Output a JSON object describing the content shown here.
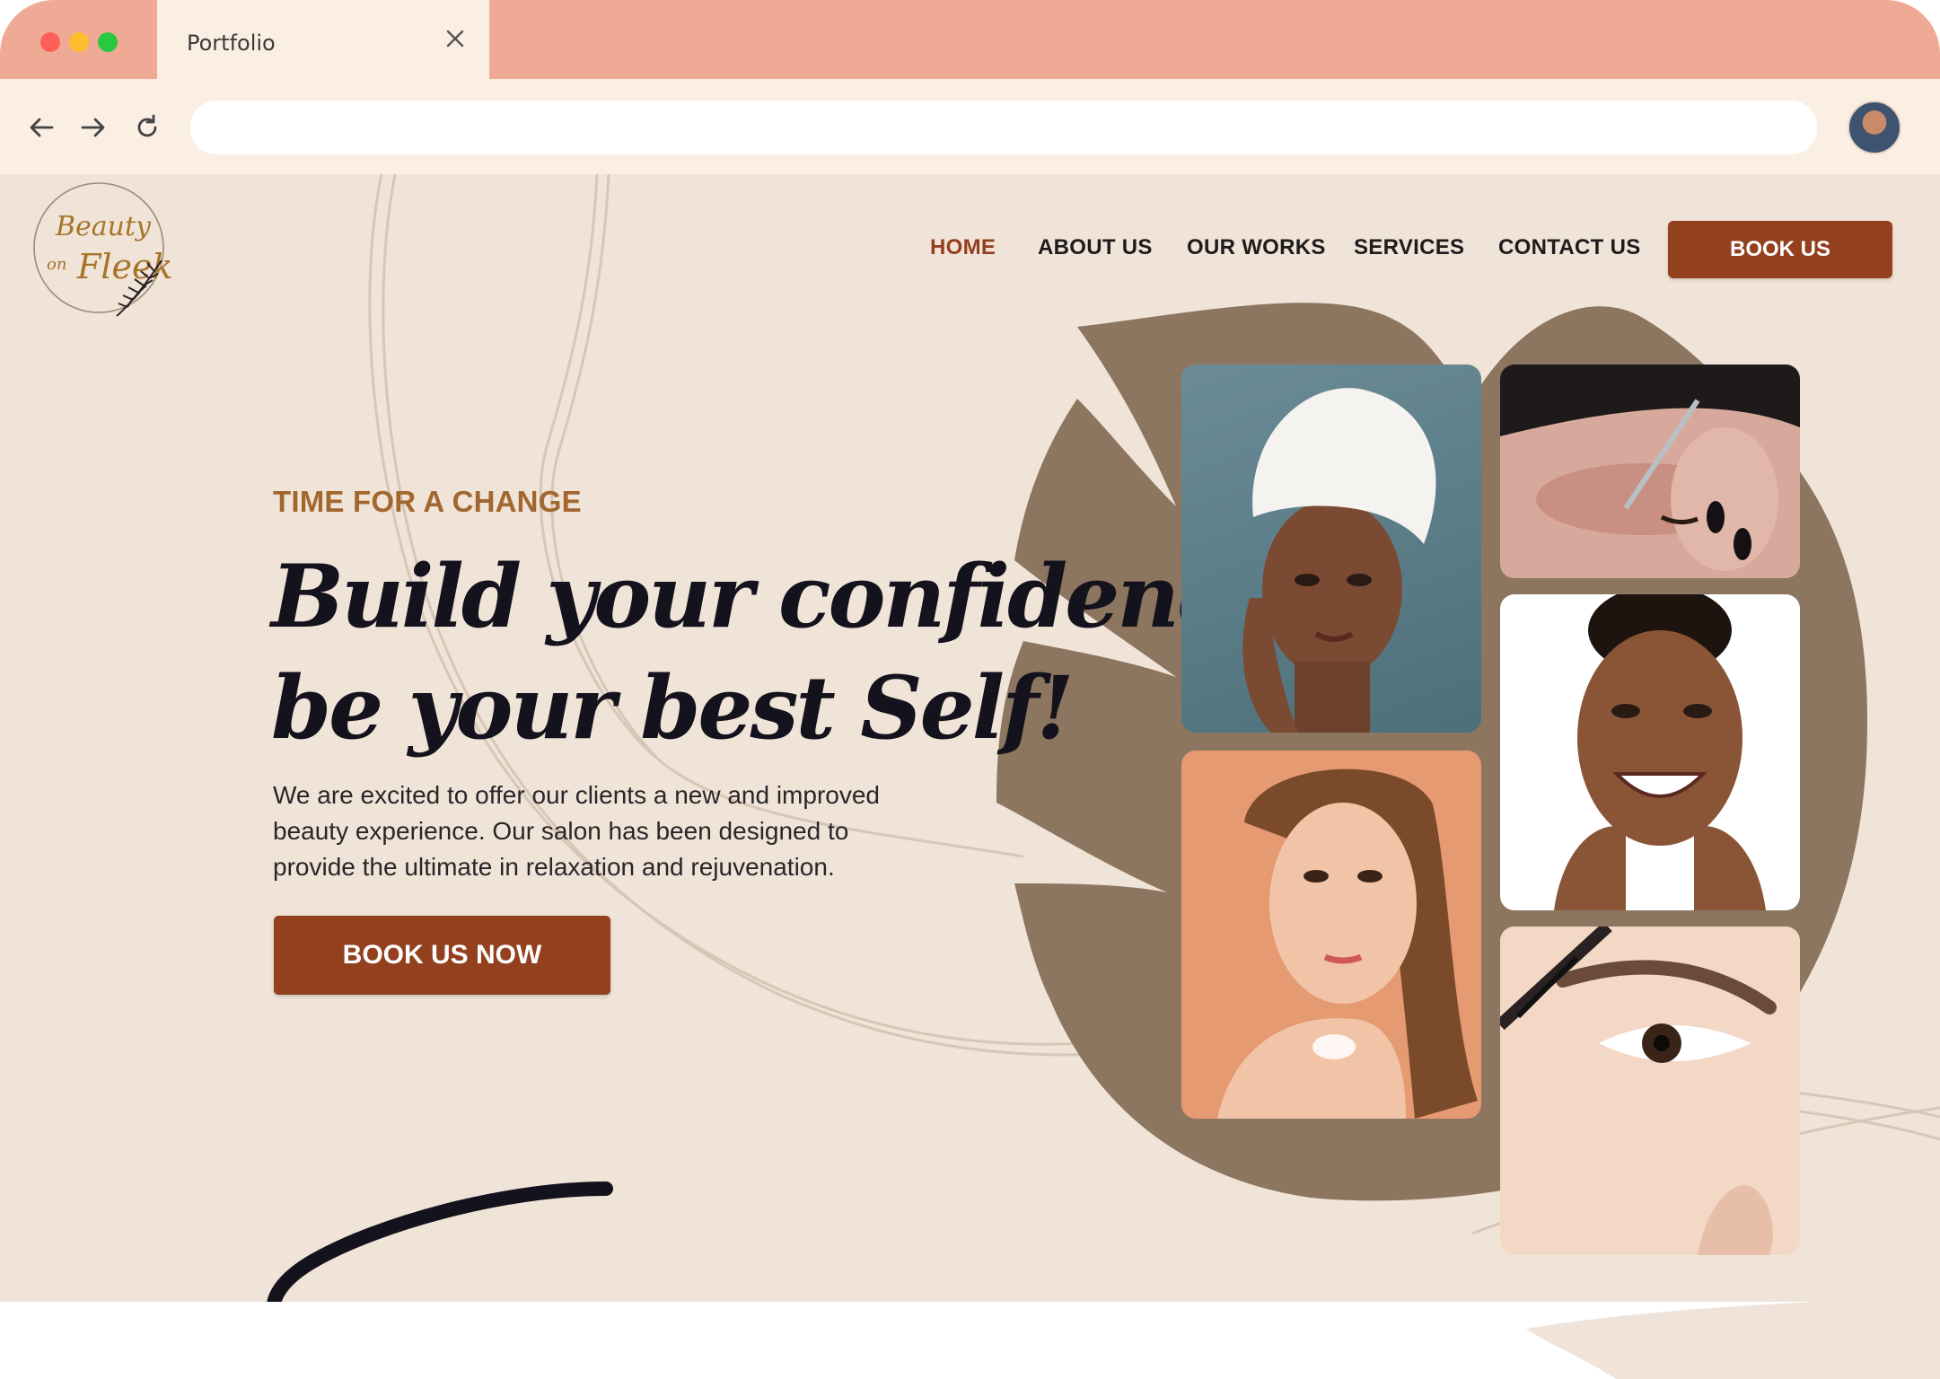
{
  "browser": {
    "tab_title": "Portfolio",
    "url": ""
  },
  "nav": {
    "items": [
      {
        "label": "HOME",
        "active": true
      },
      {
        "label": "ABOUT US",
        "active": false
      },
      {
        "label": "OUR WORKS",
        "active": false
      },
      {
        "label": "SERVICES",
        "active": false
      },
      {
        "label": "CONTACT US",
        "active": false
      }
    ],
    "book_label": "BOOK US"
  },
  "hero": {
    "kicker": "TIME FOR A CHANGE",
    "headline_line1": "Build your confidence,",
    "headline_line2": "be your best Self!",
    "description": "We are excited to offer our clients a new and improved beauty experience. Our salon has been designed to provide the ultimate in relaxation and rejuvenation.",
    "cta_label": "BOOK US NOW"
  },
  "gallery": [
    {
      "subject": "woman with towel on head"
    },
    {
      "subject": "eyelash extension application"
    },
    {
      "subject": "smiling woman touching face"
    },
    {
      "subject": "woman applying lotion on shoulder"
    },
    {
      "subject": "eyebrow grooming brush"
    }
  ],
  "colors": {
    "tabbar": "#efaa96",
    "toolbar": "#fbefe3",
    "page_bg": "#f0e4d8",
    "accent": "#93401f",
    "kicker": "#a2672f",
    "leaf": "#8d7660",
    "text_dark": "#14121c"
  }
}
